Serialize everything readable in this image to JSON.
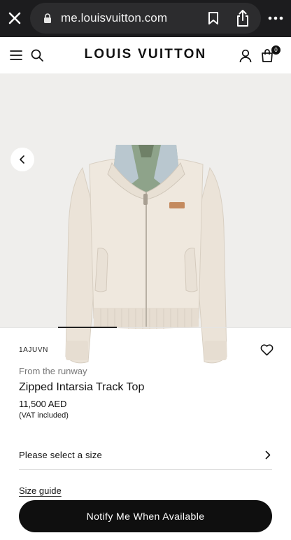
{
  "browser": {
    "url": "me.louisvuitton.com",
    "icons": [
      "close-icon",
      "lock-icon",
      "bookmark-icon",
      "share-icon",
      "more-icon"
    ]
  },
  "header": {
    "logo": "LOUIS VUITTON",
    "bag_count": "0",
    "icons": [
      "menu-icon",
      "search-icon",
      "account-icon",
      "bag-icon"
    ]
  },
  "product": {
    "sku": "1AJUVN",
    "subtitle": "From the runway",
    "name": "Zipped Intarsia Track Top",
    "price": "11,500 AED",
    "vat_note": "(VAT included)"
  },
  "size_select": {
    "label": "Please select a size"
  },
  "size_guide": {
    "label": "Size guide"
  },
  "cta": {
    "label": "Notify Me When Available"
  },
  "colors": {
    "browser_bar": "#1c1c1e",
    "url_pill": "#2c2c2e",
    "image_bg": "#efeeec",
    "cta_bg": "#0f0f0f"
  }
}
